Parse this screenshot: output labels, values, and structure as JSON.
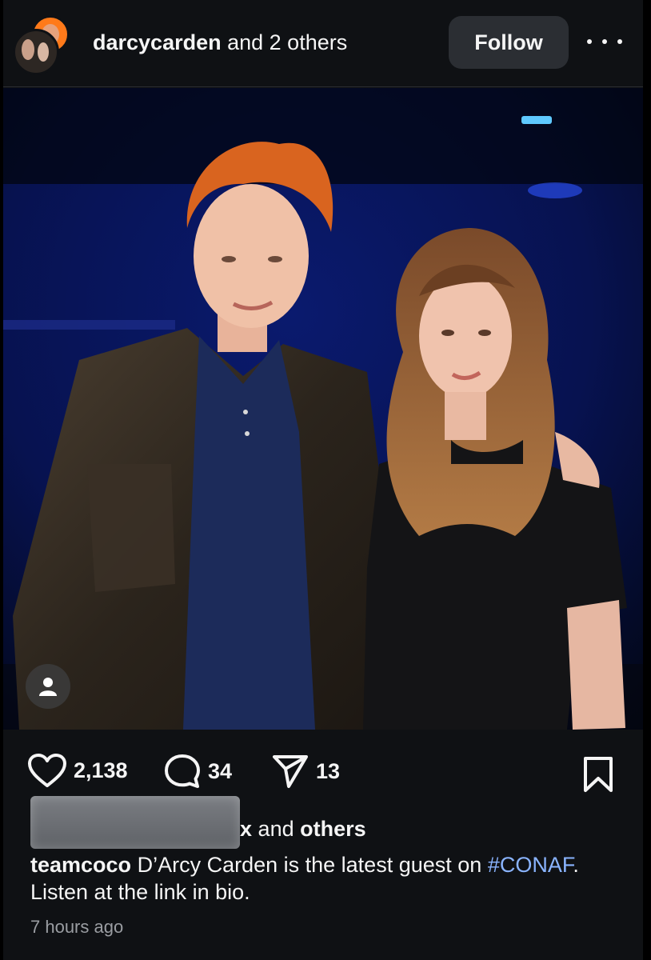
{
  "header": {
    "username": "darcycarden",
    "collab_suffix": "and 2 others",
    "follow_label": "Follow"
  },
  "photo": {
    "left_person_icon": "person-icon"
  },
  "actions": {
    "likes": "2,138",
    "comments": "34",
    "shares": "13",
    "icons": [
      "heart-icon",
      "comment-icon",
      "send-icon",
      "bookmark-icon"
    ]
  },
  "liked_by": {
    "visible_suffix": "x",
    "and_word": "and",
    "others_word": "others"
  },
  "caption": {
    "username": "teamcoco",
    "text_before_tag": "D’Arcy Carden is the latest guest on",
    "hashtag": "#CONAF",
    "text_after_tag": ". Listen at the link in bio."
  },
  "timestamp": "7 hours ago",
  "colors": {
    "background": "#0f1114",
    "follow_button": "#2b2e33",
    "hashtag": "#8ab4ff",
    "timestamp": "#9a9da2"
  }
}
